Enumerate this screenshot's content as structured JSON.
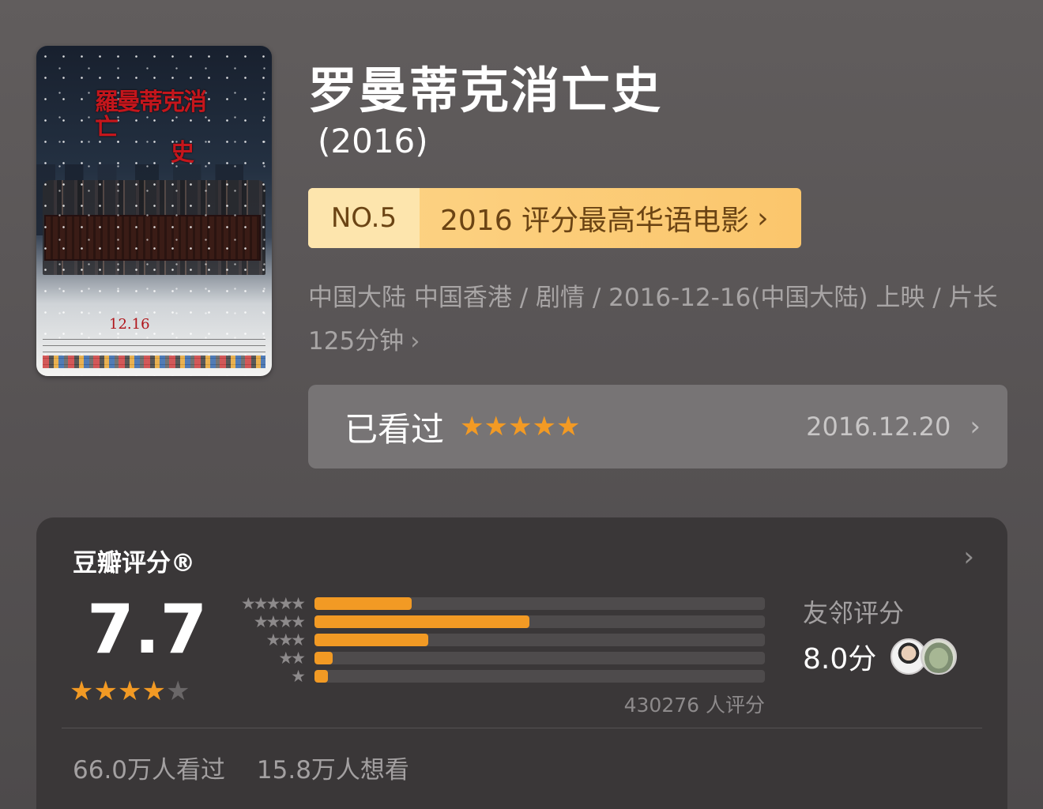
{
  "movie": {
    "title": "罗曼蒂克消亡史",
    "year": "(2016)",
    "poster": {
      "title_lines": [
        "羅曼蒂克消亡",
        "史"
      ],
      "date": "12.16"
    }
  },
  "rank": {
    "number": "NO.5",
    "label": "2016 评分最高华语电影",
    "chevron": "›"
  },
  "meta": {
    "text": "中国大陆 中国香港 / 剧情 / 2016-12-16(中国大陆) 上映 / 片长125分钟",
    "chevron": "›"
  },
  "watched": {
    "label": "已看过",
    "stars": "★★★★★",
    "date": "2016.12.20",
    "chevron": "›"
  },
  "rating": {
    "title": "豆瓣评分®",
    "chevron": "›",
    "score": "7.7",
    "stars_filled": 4,
    "stars_total": 5,
    "star_labels": [
      "★★★★★",
      "★★★★",
      "★★★",
      "★★",
      "★"
    ],
    "distribution": [
      0.215,
      0.478,
      0.253,
      0.04,
      0.03
    ],
    "votes": "430276 人评分",
    "friends": {
      "label": "友邻评分",
      "score": "8.0分",
      "avatars": [
        "person-avatar",
        "pottery-avatar"
      ]
    },
    "stats": {
      "watched": "66.0万人看过",
      "wish": "15.8万人想看"
    }
  },
  "colors": {
    "accent": "#f29a24",
    "badge_bg": "#fbc66c",
    "badge_text": "#6b4414"
  }
}
